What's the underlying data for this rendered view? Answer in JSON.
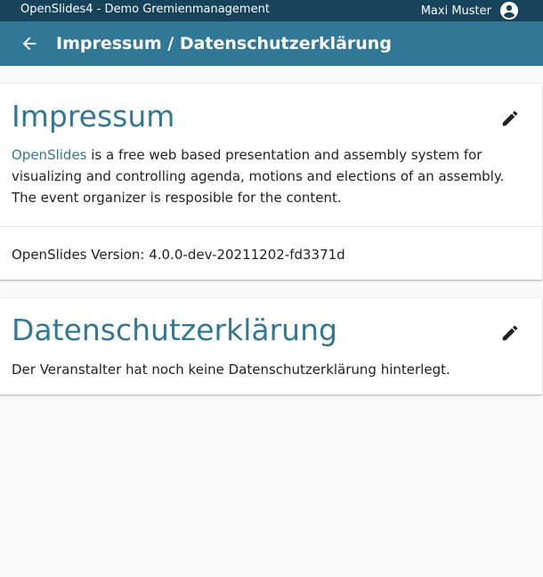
{
  "topbar": {
    "app_title": "OpenSlides4 - Demo Gremienmanagement",
    "user_name": "Maxi Muster",
    "avatar_icon": "account-circle-icon"
  },
  "toolbar": {
    "back_icon": "arrow-back-icon",
    "title": "Impressum / Datenschutzerklärung"
  },
  "impressum": {
    "heading": "Impressum",
    "edit_icon": "pencil-icon",
    "link_text": "OpenSlides",
    "body_text": " is a free web based presentation and assembly system for visualizing and controlling agenda, motions and elections of an assembly. The event organizer is resposible for the content.",
    "version_text": "OpenSlides Version: 4.0.0-dev-20211202-fd3371d"
  },
  "privacy": {
    "heading": "Datenschutzerklärung",
    "edit_icon": "pencil-icon",
    "body_text": "Der Veranstalter hat noch keine Datenschutzerklärung hinterlegt."
  },
  "colors": {
    "topbar_bg": "#16435a",
    "toolbar_bg": "#317796",
    "accent": "#317796",
    "page_bg": "#fafafa"
  }
}
